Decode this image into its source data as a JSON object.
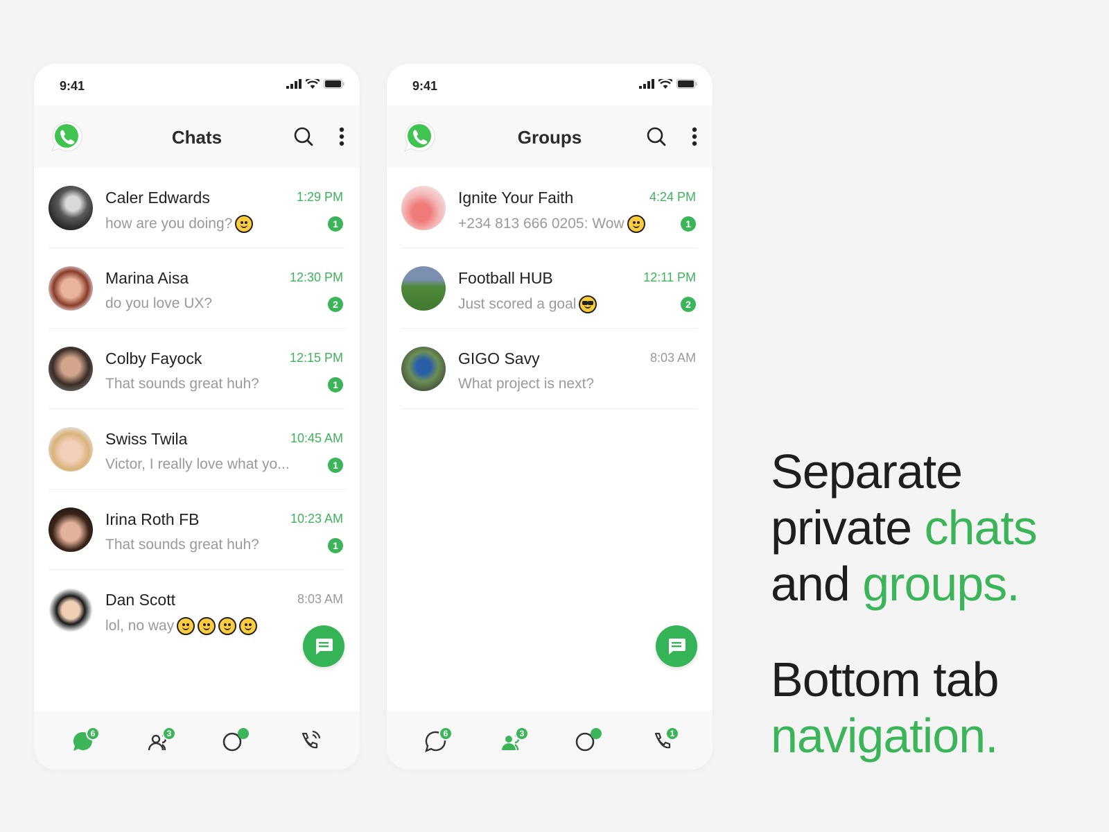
{
  "colors": {
    "accent": "#3cb55a",
    "text_dark": "#222222",
    "text_muted": "#9a9a9a"
  },
  "status": {
    "time": "9:41"
  },
  "chats_screen": {
    "title": "Chats",
    "rows": [
      {
        "name": "Caler Edwards",
        "time": "1:29 PM",
        "message": "how are you doing?",
        "badge": "1",
        "emoji": [
          "wink-emoji"
        ]
      },
      {
        "name": "Marina Aisa",
        "time": "12:30 PM",
        "message": "do you love UX?",
        "badge": "2",
        "emoji": []
      },
      {
        "name": "Colby Fayock",
        "time": "12:15 PM",
        "message": "That sounds great huh?",
        "badge": "1",
        "emoji": []
      },
      {
        "name": "Swiss Twila",
        "time": "10:45 AM",
        "message": "Victor, I really love what yo...",
        "badge": "1",
        "emoji": []
      },
      {
        "name": "Irina Roth FB",
        "time": "10:23 AM",
        "message": "That sounds great huh?",
        "badge": "1",
        "emoji": []
      },
      {
        "name": "Dan Scott",
        "time": "8:03 AM",
        "message": "lol, no way",
        "badge": "",
        "emoji": [
          "laughing-emoji",
          "laughing-emoji",
          "smiling-emoji",
          "laughing-emoji"
        ]
      }
    ],
    "nav_badges": {
      "chats": "6",
      "groups": "3"
    }
  },
  "groups_screen": {
    "title": "Groups",
    "rows": [
      {
        "name": "Ignite Your Faith",
        "time": "4:24 PM",
        "message": "+234 813 666 0205: Wow",
        "badge": "1",
        "emoji": [
          "tongue-emoji"
        ]
      },
      {
        "name": "Football HUB",
        "time": "12:11 PM",
        "message": "Just scored a goal",
        "badge": "2",
        "emoji": [
          "sunglasses-emoji"
        ]
      },
      {
        "name": "GIGO Savy",
        "time": "8:03 AM",
        "message": "What project is next?",
        "badge": "",
        "emoji": []
      }
    ],
    "nav_badges": {
      "chats": "6",
      "groups": "3",
      "calls": "1"
    }
  },
  "tagline": {
    "line1": "Separate",
    "line2_a": "private ",
    "line2_b": "chats",
    "line3_a": "and ",
    "line3_b": "groups.",
    "line4": "Bottom tab",
    "line5": "navigation."
  }
}
